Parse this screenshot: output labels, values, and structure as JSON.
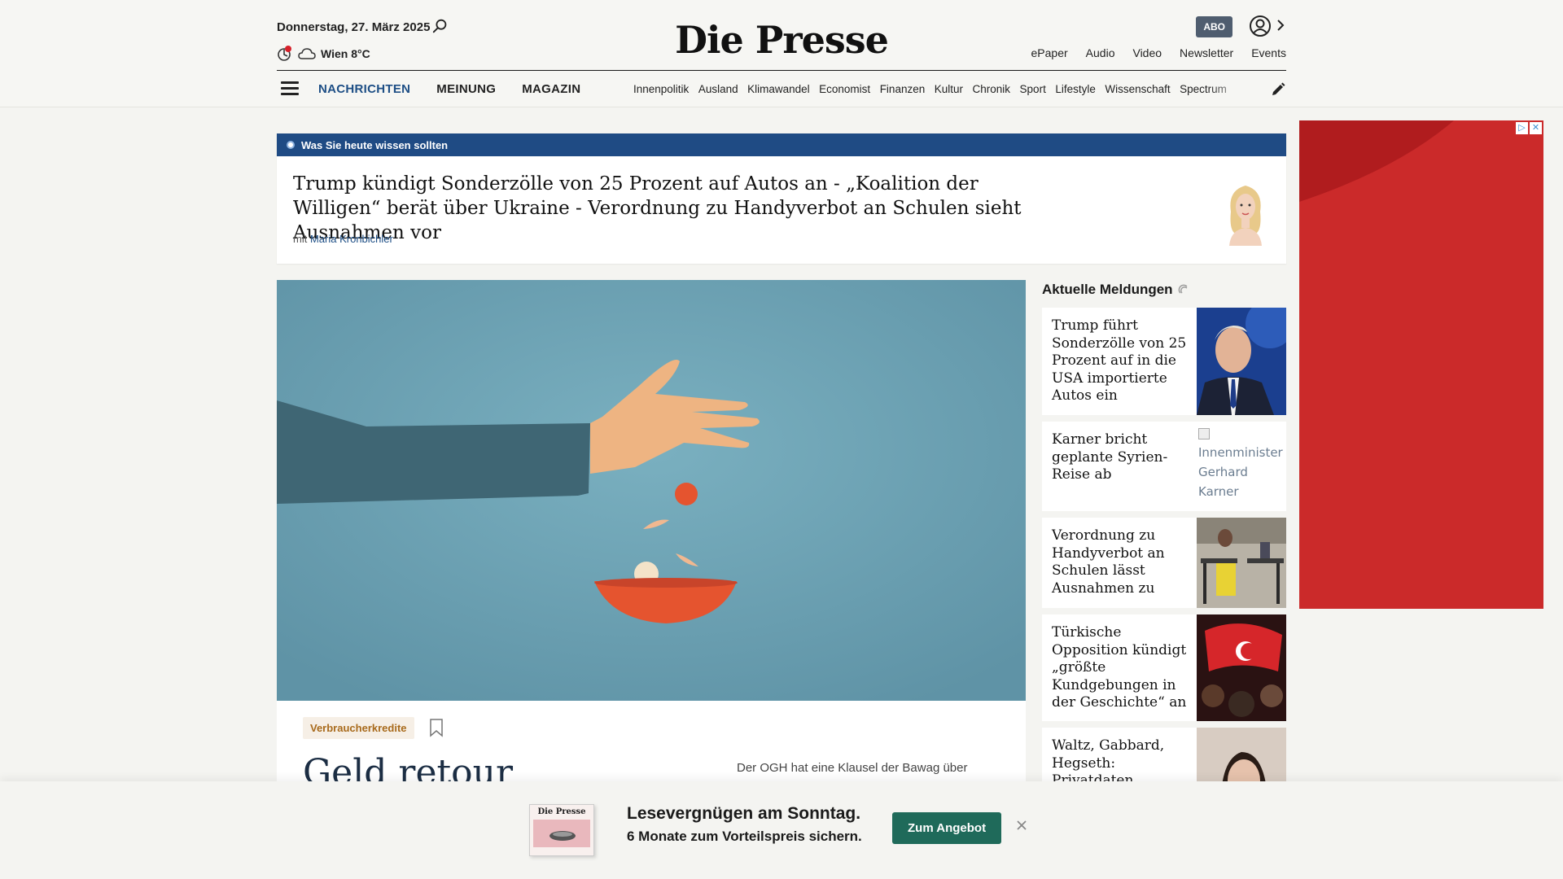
{
  "header": {
    "date": "Donnerstag, 27. März 2025",
    "weather": "Wien 8°C",
    "logo": "Die Presse",
    "abo_label": "ABO",
    "util_links": [
      "ePaper",
      "Audio",
      "Video",
      "Newsletter",
      "Events"
    ],
    "main_nav": [
      "NACHRICHTEN",
      "MEINUNG",
      "MAGAZIN"
    ],
    "sub_nav": [
      "Innenpolitik",
      "Ausland",
      "Klimawandel",
      "Economist",
      "Finanzen",
      "Kultur",
      "Chronik",
      "Sport",
      "Lifestyle",
      "Wissenschaft",
      "Spectrum"
    ]
  },
  "briefing": {
    "label": "Was Sie heute wissen sollten",
    "title": "Trump kündigt Sonderzölle von 25 Prozent auf Autos an - „Koalition der Willigen“ berät über Ukraine - Verordnung zu Handyverbot an Schulen sieht Ausnahmen vor",
    "author_prefix": "mit",
    "author_name": "Maria Kronbichler"
  },
  "hero": {
    "tag": "Verbraucherkredite",
    "headline": "Geld retour",
    "teaser": "Der OGH hat eine Klausel der Bawag über"
  },
  "sidebar": {
    "heading": "Aktuelle Meldungen",
    "items": [
      {
        "title": "Trump führt Sonderzölle von 25 Prozent auf in die USA importierte Autos ein"
      },
      {
        "title": "Karner bricht geplante Syrien-Reise ab",
        "alt": "Innenminister Gerhard Karner"
      },
      {
        "title": "Verordnung zu Handyverbot an Schulen lässt Ausnahmen zu"
      },
      {
        "title": "Türkische Opposition kündigt „größte Kundgebungen in der Geschichte“ an"
      },
      {
        "title": "Waltz, Gabbard, Hegseth: Privatdaten hochrangiger US-"
      }
    ]
  },
  "promo": {
    "cover_logo": "Die Presse",
    "line1": "Lesevergnügen am Sonntag.",
    "line2": "6 Monate zum Vorteilspreis sichern.",
    "button": "Zum Angebot"
  },
  "colors": {
    "brand_blue": "#1f4b84",
    "nav_active": "#1d4e85",
    "promo_button": "#1f6a5a",
    "ad_red": "#c8292a",
    "tag_text": "#a86a1b"
  },
  "icons": [
    "search-icon",
    "weather-icon",
    "cloud-icon",
    "user-icon",
    "chevron-right-icon",
    "menu-icon",
    "pencil-icon",
    "bookmark-icon",
    "close-icon"
  ]
}
